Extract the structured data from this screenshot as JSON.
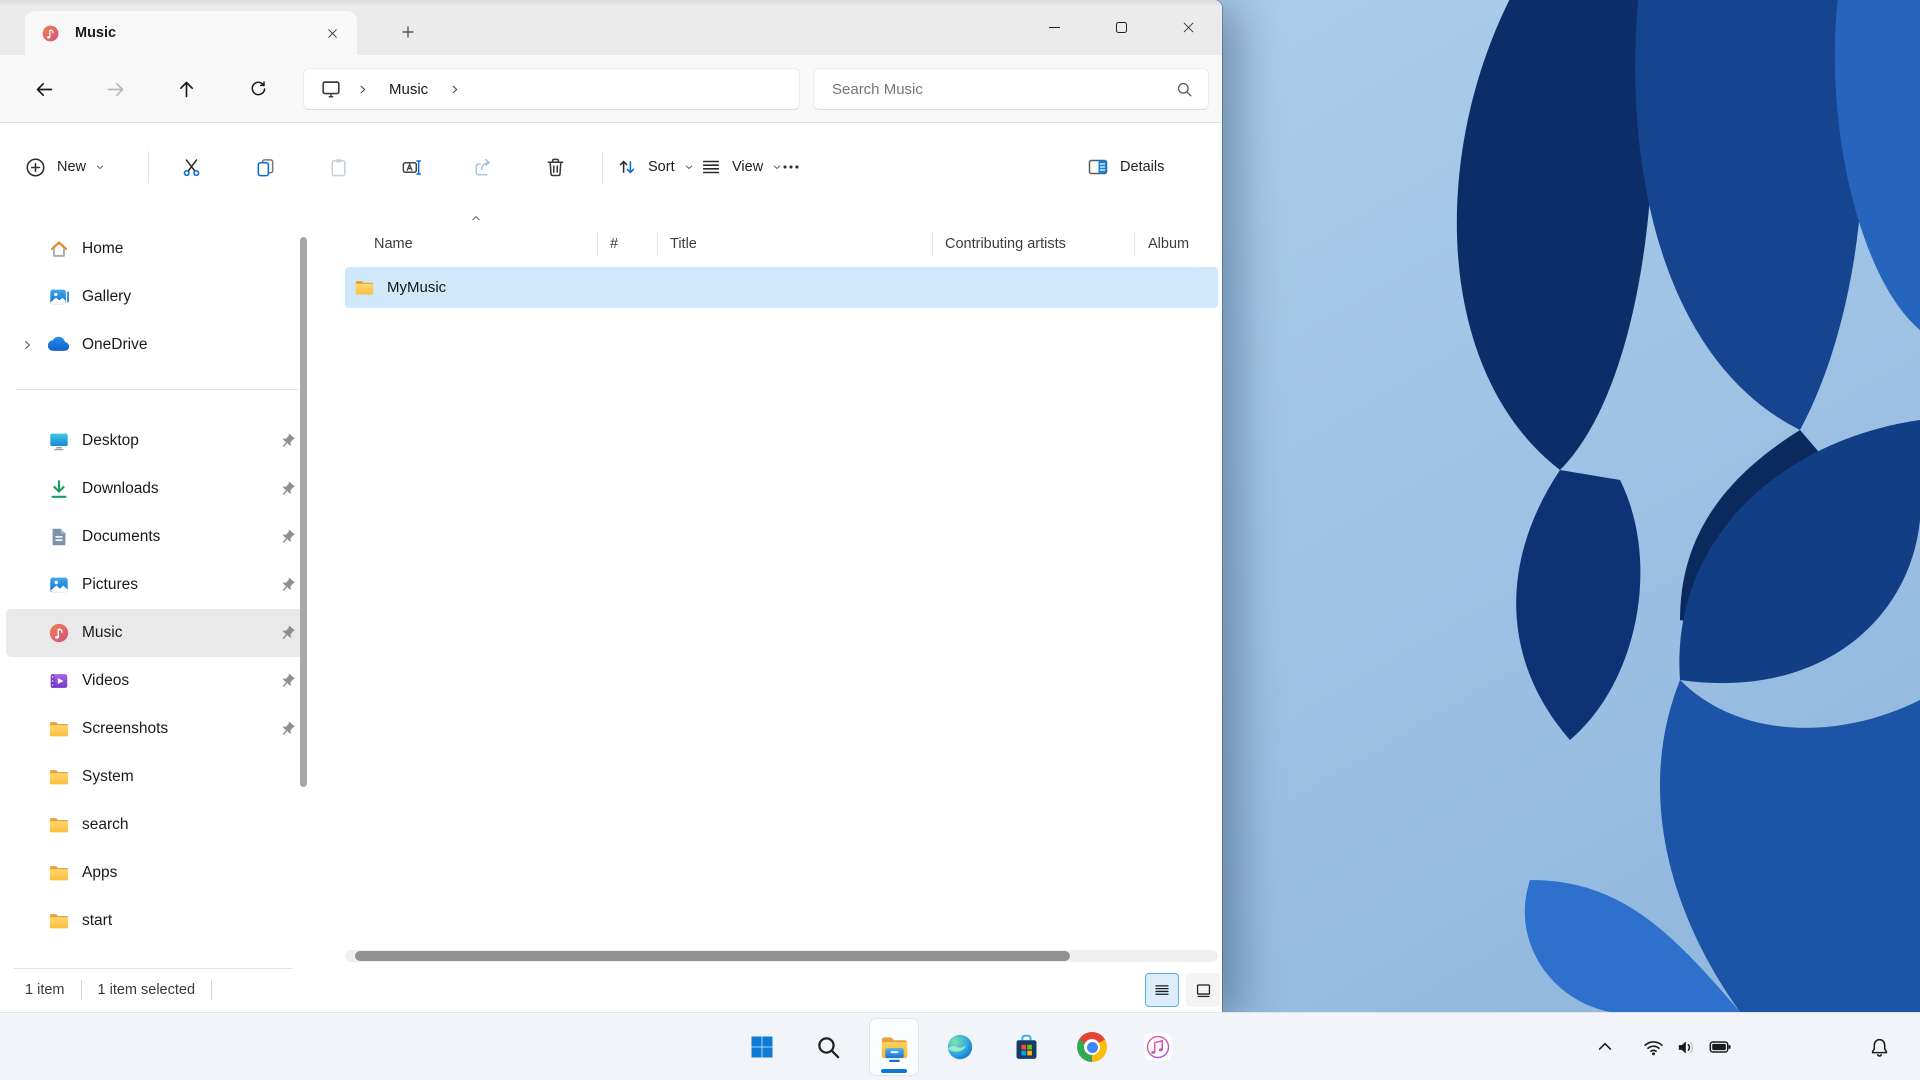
{
  "window": {
    "tab": {
      "title": "Music",
      "icon": "music-folder-icon"
    },
    "controls": [
      "minimize",
      "maximize",
      "close"
    ]
  },
  "navbar": {
    "breadcrumb": {
      "root_icon": "this-pc-monitor-icon",
      "path": [
        "Music"
      ]
    },
    "search_placeholder": "Search Music"
  },
  "toolbar": {
    "new_label": "New",
    "sort_label": "Sort",
    "view_label": "View",
    "details_label": "Details",
    "actions": [
      "cut",
      "copy",
      "paste",
      "rename",
      "share",
      "delete",
      "more"
    ]
  },
  "sidebar": {
    "items": [
      {
        "label": "Home",
        "icon": "home-icon",
        "pinned": false,
        "selected": false
      },
      {
        "label": "Gallery",
        "icon": "gallery-icon",
        "pinned": false,
        "selected": false
      },
      {
        "label": "OneDrive",
        "icon": "onedrive-icon",
        "pinned": false,
        "selected": false,
        "expandable": true
      },
      {
        "label": "Desktop",
        "icon": "desktop-icon",
        "pinned": true,
        "selected": false
      },
      {
        "label": "Downloads",
        "icon": "downloads-icon",
        "pinned": true,
        "selected": false
      },
      {
        "label": "Documents",
        "icon": "documents-icon",
        "pinned": true,
        "selected": false
      },
      {
        "label": "Pictures",
        "icon": "pictures-icon",
        "pinned": true,
        "selected": false
      },
      {
        "label": "Music",
        "icon": "music-icon",
        "pinned": true,
        "selected": true
      },
      {
        "label": "Videos",
        "icon": "videos-icon",
        "pinned": true,
        "selected": false
      },
      {
        "label": "Screenshots",
        "icon": "folder-icon",
        "pinned": true,
        "selected": false
      },
      {
        "label": "System",
        "icon": "folder-icon",
        "pinned": false,
        "selected": false
      },
      {
        "label": "search",
        "icon": "folder-icon",
        "pinned": false,
        "selected": false
      },
      {
        "label": "Apps",
        "icon": "folder-icon",
        "pinned": false,
        "selected": false
      },
      {
        "label": "start",
        "icon": "folder-icon",
        "pinned": false,
        "selected": false
      }
    ]
  },
  "filelist": {
    "columns": [
      "Name",
      "#",
      "Title",
      "Contributing artists",
      "Album"
    ],
    "sort": {
      "column": "Name",
      "direction": "ascending"
    },
    "rows": [
      {
        "name": "MyMusic",
        "icon": "folder-icon",
        "selected": true
      }
    ]
  },
  "statusbar": {
    "count": "1 item",
    "selection": "1 item selected"
  },
  "taskbar": {
    "apps": [
      "start",
      "search",
      "file-explorer",
      "edge",
      "microsoft-store",
      "chrome",
      "music-app"
    ],
    "active_app": "file-explorer",
    "tray_icons": [
      "chevron-up",
      "wifi",
      "volume",
      "battery",
      "bell"
    ]
  },
  "colors": {
    "accent": "#0b77d8",
    "selection_blue": "#cfe8fc",
    "sidebar_selected": "#e9e9e9",
    "taskbar_bg": "#f1f5fa",
    "wallpaper_base": "#a6c9e8",
    "bloom": [
      "#0b2d68",
      "#16448f",
      "#2565bd",
      "#123e85"
    ]
  }
}
